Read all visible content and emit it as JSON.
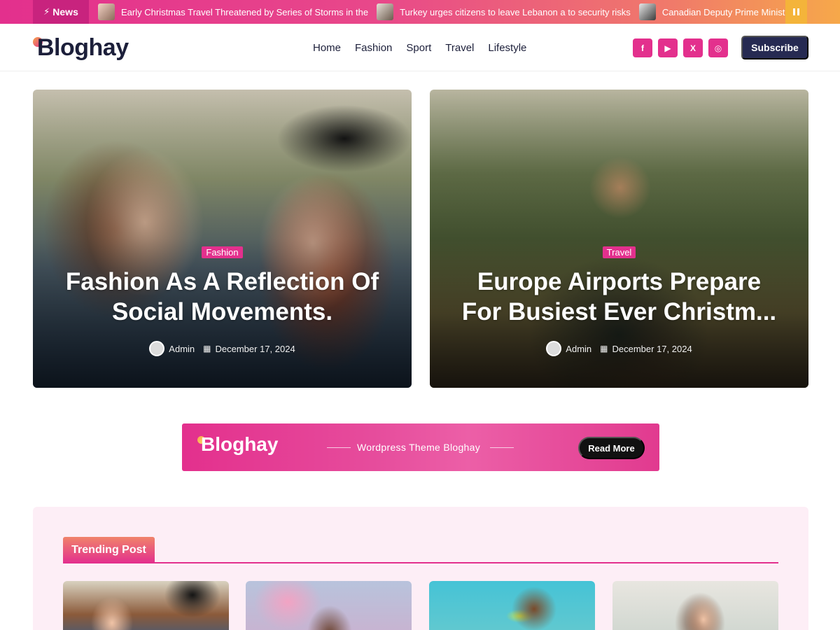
{
  "ticker": {
    "badge_label": "News",
    "items": [
      {
        "text": "Early Christmas Travel Threatened by Series of Storms in the"
      },
      {
        "text": "Turkey urges citizens to leave Lebanon a to security risks"
      },
      {
        "text": "Canadian Deputy Prime Minister"
      }
    ]
  },
  "header": {
    "logo_text": "Bloghay",
    "nav": [
      "Home",
      "Fashion",
      "Sport",
      "Travel",
      "Lifestyle"
    ],
    "social": [
      {
        "icon": "facebook-icon",
        "glyph": "f"
      },
      {
        "icon": "youtube-icon",
        "glyph": "▶"
      },
      {
        "icon": "x-icon",
        "glyph": "X"
      },
      {
        "icon": "instagram-icon",
        "glyph": "◎"
      }
    ],
    "subscribe_label": "Subscribe"
  },
  "hero": [
    {
      "category": "Fashion",
      "title": "Fashion As A Reflection Of Social Movements.",
      "author": "Admin",
      "date": "December 17, 2024"
    },
    {
      "category": "Travel",
      "title": "Europe Airports Prepare For Busiest Ever Christm...",
      "author": "Admin",
      "date": "December 17, 2024"
    }
  ],
  "banner": {
    "logo_text": "Bloghay",
    "tagline": "Wordpress Theme Bloghay",
    "button_label": "Read More"
  },
  "trending": {
    "title": "Trending Post"
  },
  "colors": {
    "accent": "#e3308d",
    "navy": "#262a52",
    "orange": "#f6a84a"
  }
}
